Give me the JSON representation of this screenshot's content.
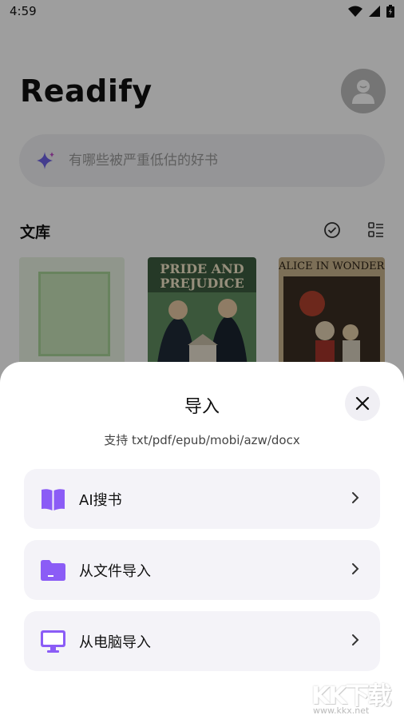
{
  "status_bar": {
    "time": "4:59"
  },
  "header": {
    "app_title": "Readify"
  },
  "search": {
    "placeholder": "有哪些被严重低估的好书"
  },
  "library": {
    "title": "文库",
    "books": [
      {
        "title": ""
      },
      {
        "title": "PRIDE AND PREJUDICE"
      },
      {
        "title": "ALICE IN WONDERLAND"
      }
    ]
  },
  "import_sheet": {
    "title": "导入",
    "subtitle": "支持 txt/pdf/epub/mobi/azw/docx",
    "options": [
      {
        "label": "AI搜书",
        "icon": "open-book-icon"
      },
      {
        "label": "从文件导入",
        "icon": "folder-icon"
      },
      {
        "label": "从电脑导入",
        "icon": "monitor-icon"
      }
    ]
  },
  "watermark": {
    "brand": "KK下载",
    "url": "www.kkx.net"
  },
  "colors": {
    "accent": "#8b5cf6",
    "sheet_bg": "#ffffff",
    "option_bg": "#f4f3f8",
    "overlay": "rgba(0,0,0,0.38)"
  }
}
